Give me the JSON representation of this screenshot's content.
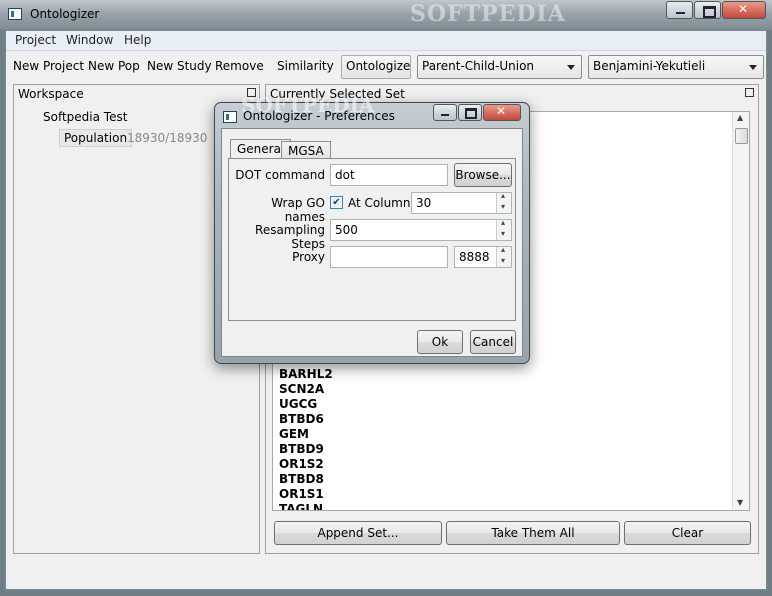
{
  "window": {
    "title": "Ontologizer",
    "watermark": "SOFTPEDIA"
  },
  "menu": [
    "Project",
    "Window",
    "Help"
  ],
  "toolbar": {
    "new_project": "New Project",
    "new_pop": "New Pop",
    "new_study": "New Study",
    "remove": "Remove",
    "similarity": "Similarity",
    "ontologize": "Ontologize",
    "method": "Parent-Child-Union",
    "mtc": "Benjamini-Yekutieli"
  },
  "workspace": {
    "title": "Workspace",
    "project": "Softpedia Test",
    "population_label": "Population",
    "population_count": "18930/18930"
  },
  "selected_set": {
    "title": "Currently Selected Set",
    "genes": [
      "BARHL2",
      "SCN2A",
      "UGCG",
      "BTBD6",
      "GEM",
      "BTBD9",
      "OR1S2",
      "BTBD8",
      "OR1S1",
      "TAGLN"
    ],
    "append_button": "Append Set...",
    "take_all_button": "Take Them All",
    "clear_button": "Clear"
  },
  "dialog": {
    "title": "Ontologizer - Preferences",
    "watermark": "SOFTPEDIA",
    "tabs": [
      "General",
      "MGSA"
    ],
    "dot_label": "DOT command",
    "dot_value": "dot",
    "browse": "Browse...",
    "wrap_label": "Wrap GO names",
    "wrap_checked": true,
    "at_column_label": "At Column",
    "at_column_value": "30",
    "resampling_label": "Resampling Steps",
    "resampling_value": "500",
    "proxy_label": "Proxy",
    "proxy_host": "",
    "proxy_port": "8888",
    "ok": "Ok",
    "cancel": "Cancel"
  }
}
